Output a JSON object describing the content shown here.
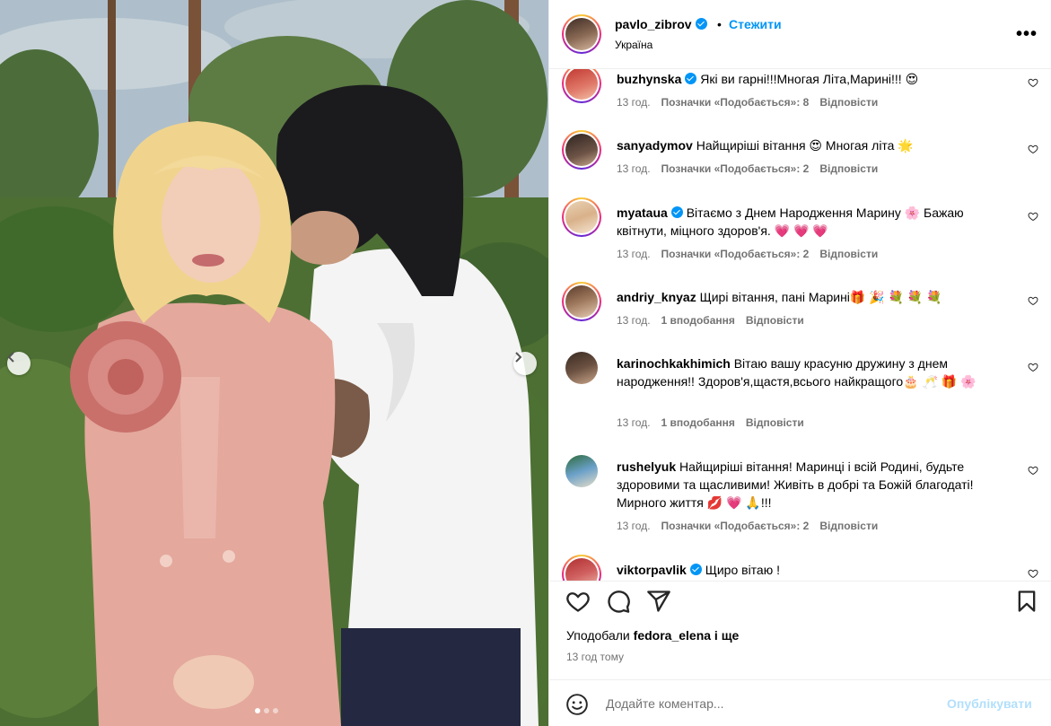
{
  "post": {
    "username": "pavlo_zibrov",
    "separator": "•",
    "follow_label": "Стежити",
    "location": "Україна",
    "more_label": "•••"
  },
  "carousel": {
    "dots": 3,
    "active": 0
  },
  "comments": [
    {
      "username": "buzhynska",
      "verified": true,
      "text": "Які ви гарні!!!Многая Літа,Марині!!! 😍",
      "time": "13 год.",
      "likes": "Позначки «Подобається»: 8",
      "reply": "Відповісти"
    },
    {
      "username": "sanyadymov",
      "verified": false,
      "text": "Найщиріші вітання 😍 Многая літа 🌟",
      "time": "13 год.",
      "likes": "Позначки «Подобається»: 2",
      "reply": "Відповісти"
    },
    {
      "username": "myataua",
      "verified": true,
      "text": "Вітаємо з Днем Народження Марину 🌸 Бажаю квітнути, міцного здоров'я. 💗 💗 💗",
      "time": "13 год.",
      "likes": "Позначки «Подобається»: 2",
      "reply": "Відповісти"
    },
    {
      "username": "andriy_knyaz",
      "verified": false,
      "text": "Щирі вітання, пані Марині🎁 🎉 💐 💐 💐",
      "time": "13 год.",
      "likes": "1 вподобання",
      "reply": "Відповісти"
    },
    {
      "username": "karinochkakhimich",
      "verified": false,
      "text": "Вітаю вашу красуню дружину з днем народження!! Здоров'я,щастя,всього найкращого🎂 🥂 🎁 🌸",
      "time": "13 год.",
      "likes": "1 вподобання",
      "reply": "Відповісти"
    },
    {
      "username": "rushelyuk",
      "verified": false,
      "text": "Найщиріші вітання! Маринці і всій Родині, будьте здоровими та щасливими! Живіть в добрі та Божій благодаті! Мирного життя 💋 💗 🙏!!!",
      "time": "13 год.",
      "likes": "Позначки «Подобається»: 2",
      "reply": "Відповісти"
    },
    {
      "username": "viktorpavlik",
      "verified": true,
      "text": "Щиро вітаю !",
      "time": "",
      "likes": "",
      "reply": ""
    }
  ],
  "likes_line": {
    "prefix": "Уподобали",
    "user": "fedora_elena",
    "suffix": "і ще"
  },
  "post_time": "13 год тому",
  "comment_box": {
    "placeholder": "Додайте коментар...",
    "post_label": "Опублікувати"
  },
  "icons": {
    "like": "heart-icon",
    "comment": "comment-icon",
    "share": "share-icon",
    "save": "bookmark-icon",
    "emoji": "emoji-icon",
    "prev": "chevron-left-icon",
    "next": "chevron-right-icon"
  },
  "colors": {
    "accent": "#0095f6",
    "muted": "#737373",
    "post_disabled": "#b2dffc"
  }
}
